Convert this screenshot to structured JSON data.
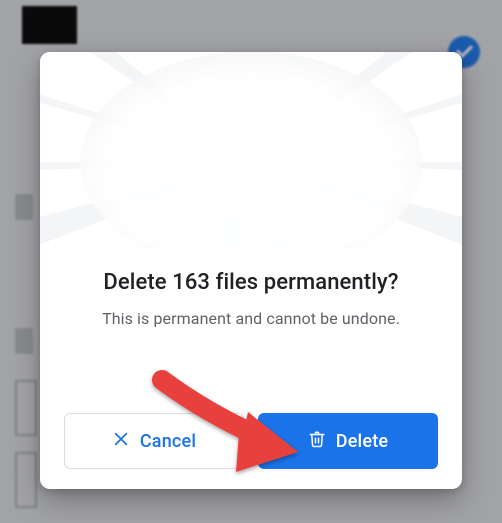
{
  "dialog": {
    "title": "Delete 163 files permanently?",
    "subtitle": "This is permanent and cannot be undone.",
    "cancel_label": "Cancel",
    "delete_label": "Delete"
  },
  "colors": {
    "primary": "#1a73e8",
    "text": "#202124",
    "secondary_text": "#5f6368",
    "border": "#dadce0",
    "arrow": "#e8403d"
  }
}
